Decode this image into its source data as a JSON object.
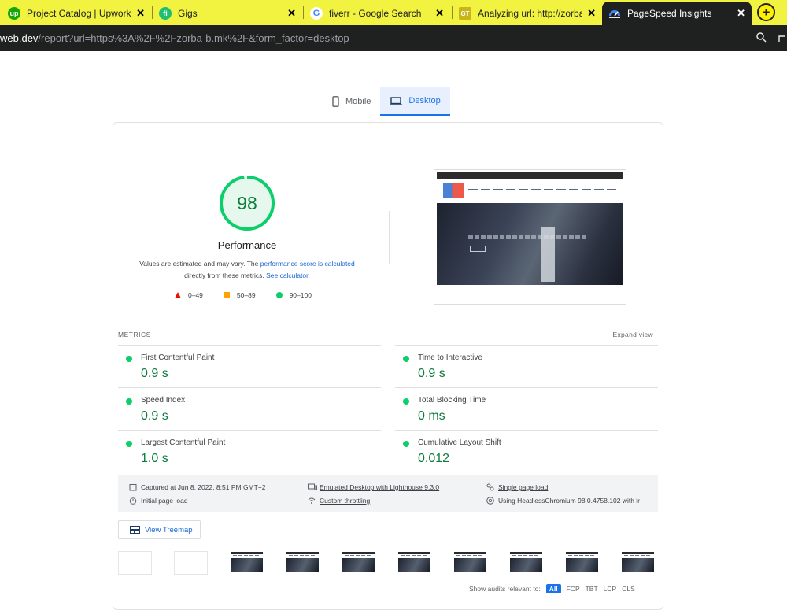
{
  "browser": {
    "tabs": [
      {
        "title": "Project Catalog | Upwork",
        "favicon": "up",
        "color": "#14a800"
      },
      {
        "title": "Gigs",
        "favicon": "fi",
        "color": "#1dbf73"
      },
      {
        "title": "fiverr - Google Search",
        "favicon": "G",
        "color": "#4285f4"
      },
      {
        "title": "Analyzing url: http://zorba-",
        "favicon": "GT",
        "color": "#c9b41a"
      },
      {
        "title": "PageSpeed Insights",
        "favicon": "",
        "color": "#4285f4"
      }
    ],
    "url_host": "web.dev",
    "url_path": "/report?url=https%3A%2F%2Fzorba-b.mk%2F&form_factor=desktop"
  },
  "form_factor": {
    "mobile": "Mobile",
    "desktop": "Desktop"
  },
  "performance": {
    "score": "98",
    "score_value": 0.98,
    "title": "Performance",
    "desc_prefix": "Values are estimated and may vary. The",
    "desc_link": "performance score is calculated",
    "desc_mid": "directly from these metrics.",
    "desc_calc": "See calculator.",
    "legend": {
      "fail": "0–49",
      "average": "50–89",
      "pass": "90–100"
    },
    "colors": {
      "pass": "#0cce6b",
      "average": "#ffa400",
      "fail": "#eb0f00"
    }
  },
  "metrics": {
    "label": "METRICS",
    "expand": "Expand view",
    "items": [
      {
        "name": "First Contentful Paint",
        "value": "0.9 s"
      },
      {
        "name": "Time to Interactive",
        "value": "0.9 s"
      },
      {
        "name": "Speed Index",
        "value": "0.9 s"
      },
      {
        "name": "Total Blocking Time",
        "value": "0 ms"
      },
      {
        "name": "Largest Contentful Paint",
        "value": "1.0 s"
      },
      {
        "name": "Cumulative Layout Shift",
        "value": "0.012"
      }
    ]
  },
  "runtime": {
    "captured": "Captured at Jun 8, 2022, 8:51 PM GMT+2",
    "initial_load": "Initial page load",
    "emulated": "Emulated Desktop with Lighthouse 9.3.0",
    "throttling": "Custom throttling",
    "single_load": "Single page load",
    "headless": "Using HeadlessChromium 98.0.4758.102 with lr"
  },
  "treemap": "View Treemap",
  "filter": {
    "label": "Show audits relevant to:",
    "all": "All",
    "options": [
      "FCP",
      "TBT",
      "LCP",
      "CLS"
    ]
  }
}
